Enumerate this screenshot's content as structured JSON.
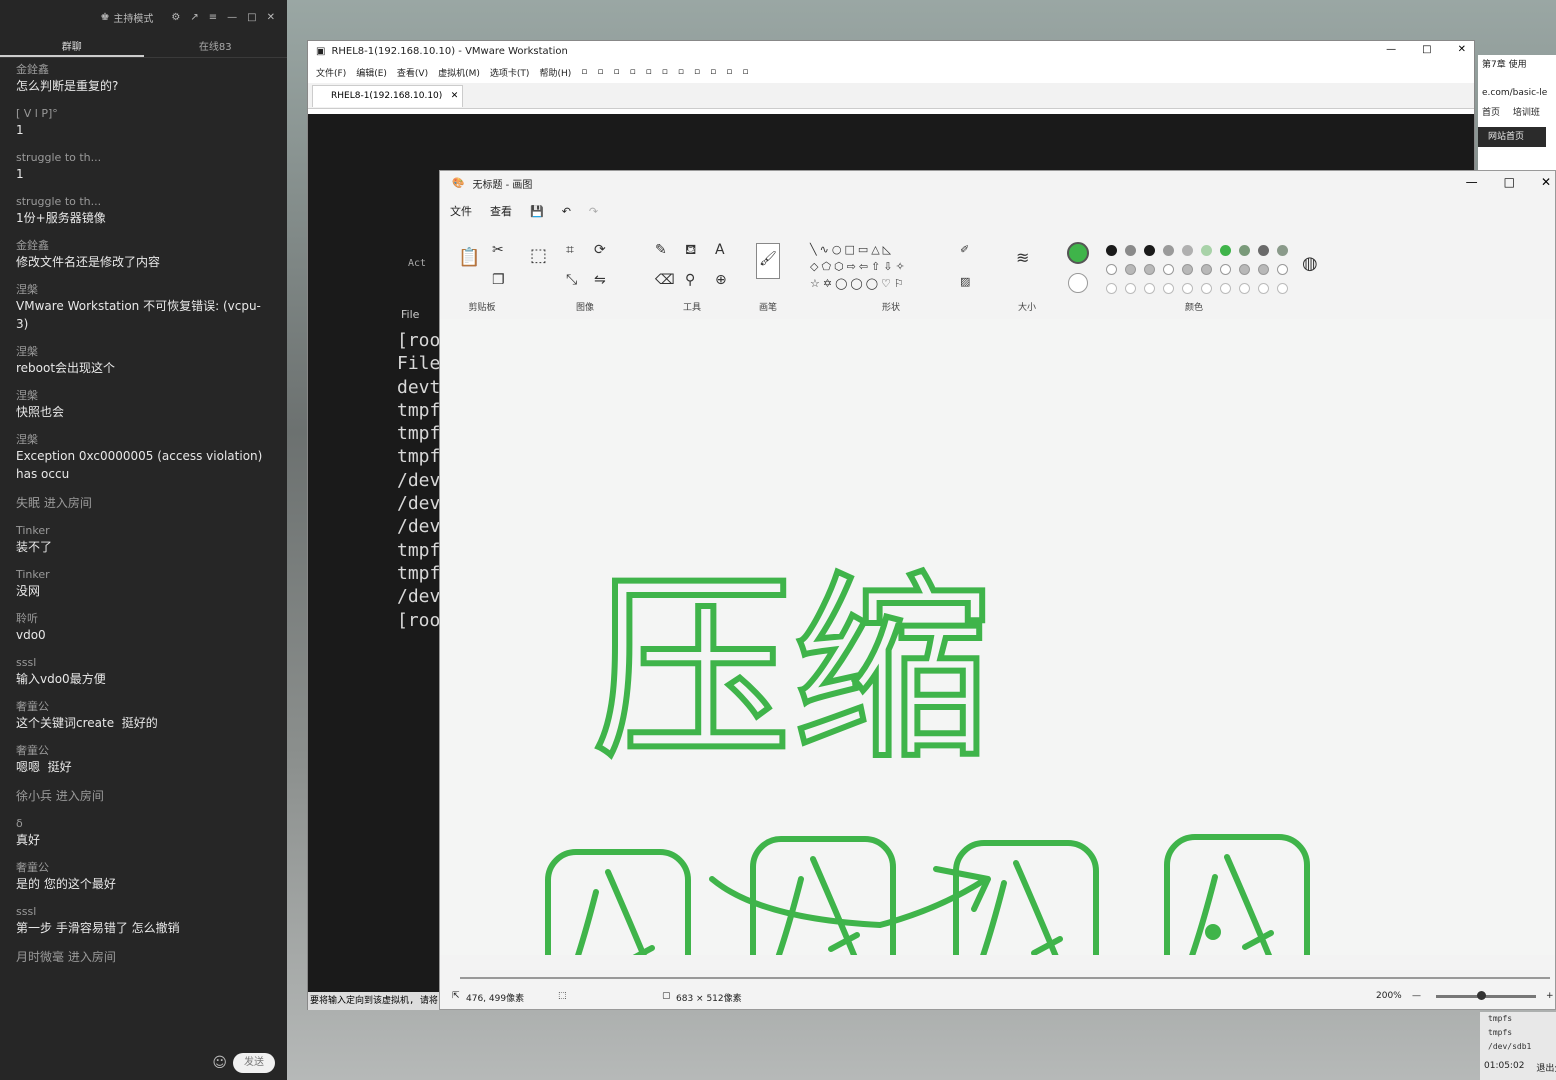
{
  "chat": {
    "title": "主持模式",
    "tab_group": "群聊",
    "tab_online": "在线83",
    "messages": [
      {
        "nick": "金銓鑫",
        "text": "怎么判断是重复的?"
      },
      {
        "nick": "[     V       l       P]°",
        "text": "1"
      },
      {
        "nick": "struggle to th...",
        "text": "1"
      },
      {
        "nick": "struggle to th...",
        "text": "1份+服务器镜像"
      },
      {
        "nick": "金銓鑫",
        "text": "修改文件名还是修改了内容"
      },
      {
        "nick": "涅槃",
        "text": "VMware Workstation 不可恢复错误: (vcpu-3)"
      },
      {
        "nick": "涅槃",
        "text": "reboot会出现这个"
      },
      {
        "nick": "涅槃",
        "text": "快照也会"
      },
      {
        "nick": "涅槃",
        "text": "Exception 0xc0000005 (access violation) has occu"
      },
      {
        "system": "失眠 进入房间"
      },
      {
        "nick": "Tinker",
        "text": "装不了"
      },
      {
        "nick": "Tinker",
        "text": "没网"
      },
      {
        "nick": "聆听",
        "text": "vdo0"
      },
      {
        "nick": "sssl",
        "text": "输入vdo0最方便"
      },
      {
        "nick": "奢童公",
        "text": "这个关键词create  挺好的"
      },
      {
        "nick": "奢童公",
        "text": "嗯嗯  挺好"
      },
      {
        "system": "徐小兵 进入房间"
      },
      {
        "nick": "δ",
        "text": "真好"
      },
      {
        "nick": "奢童公",
        "text": "是的 您的这个最好"
      },
      {
        "nick": "sssl",
        "text": "第一步 手滑容易错了 怎么撤销"
      },
      {
        "system": "月时微毫 进入房间"
      }
    ],
    "send_label": "发送"
  },
  "vmware": {
    "title": "RHEL8-1(192.168.10.10) - VMware Workstation",
    "menu": [
      "文件(F)",
      "编辑(E)",
      "查看(V)",
      "虚拟机(M)",
      "选项卡(T)",
      "帮助(H)"
    ],
    "tab": "RHEL8-1(192.168.10.10)",
    "activities": "Act",
    "file_label": "File",
    "terminal_lines": [
      "[roo",
      "File",
      "devt",
      "tmpf",
      "tmpf",
      "tmpf",
      "/dev",
      "/dev",
      "/dev",
      "tmpf",
      "tmpf",
      "/dev",
      "[roo"
    ],
    "status": "要将输入定向到该虚拟机, 请将"
  },
  "browser": {
    "tab": "第7章 使用",
    "url": "e.com/basic-le",
    "nav1": "首页",
    "nav2": "培训班",
    "button": "网站首页"
  },
  "tray": {
    "term_lines": [
      "tmpfs",
      "tmpfs",
      "/dev/sdb1"
    ],
    "time": "01:05:02",
    "exit_share": "退出分享"
  },
  "paint": {
    "title": "无标题 - 画图",
    "menu_file": "文件",
    "menu_view": "查看",
    "groups": {
      "clipboard": "剪贴板",
      "image": "图像",
      "tools": "工具",
      "brush": "画笔",
      "shapes": "形状",
      "size": "大小",
      "colors": "颜色"
    },
    "accent_color": "#3fb44a",
    "canvas_text": "压缩",
    "status": {
      "cursor": "476, 499像素",
      "size": "683 × 512像素",
      "zoom": "200%"
    },
    "zoom_fraction": 0.45
  }
}
